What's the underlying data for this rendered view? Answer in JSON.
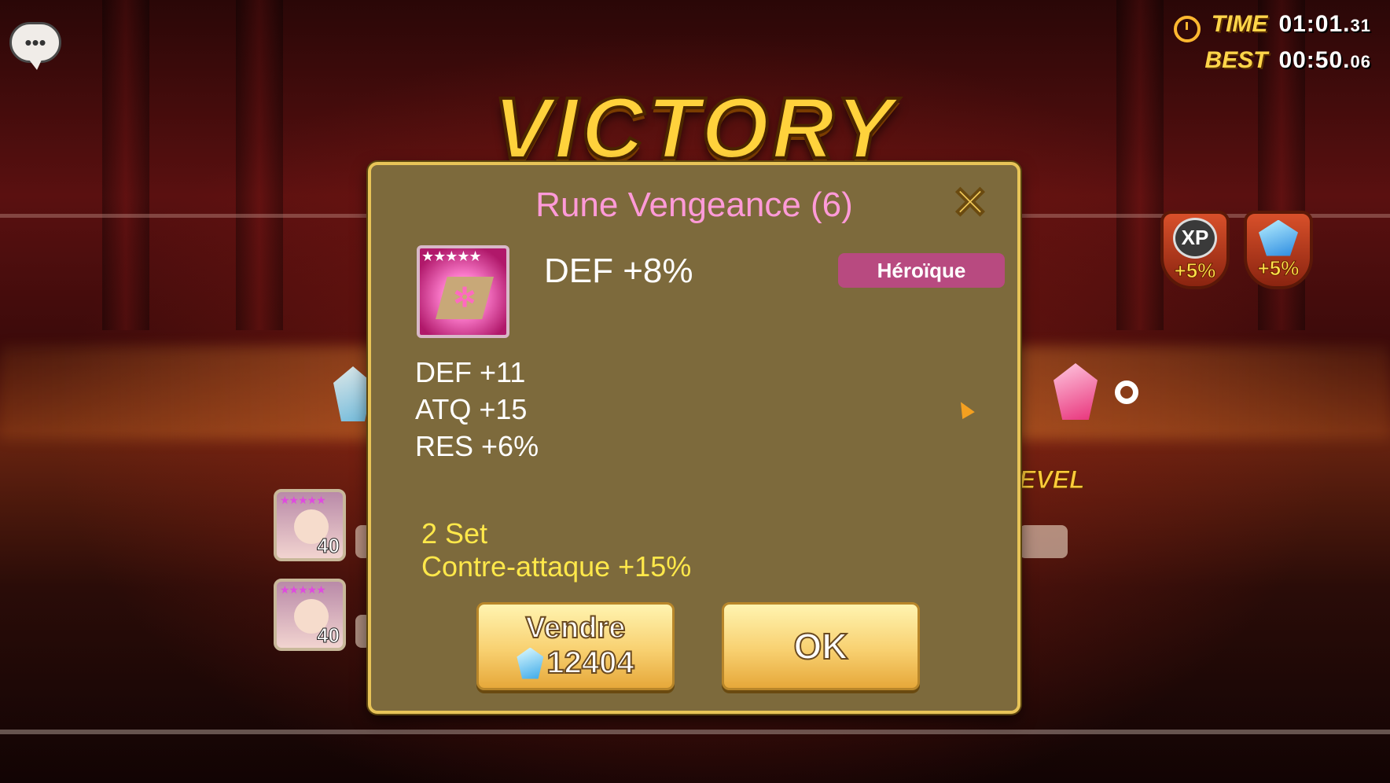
{
  "timer": {
    "time_label": "TIME",
    "time_main": "01:01.",
    "time_frac": "31",
    "best_label": "BEST",
    "best_main": "00:50.",
    "best_frac": "06"
  },
  "banner": {
    "title": "VICTORY"
  },
  "chat": {
    "icon": "chat-bubble-icon",
    "glyph": "•••"
  },
  "bonuses": [
    {
      "icon": "xp-icon",
      "icon_text": "XP",
      "value": "+5%"
    },
    {
      "icon": "crystal-icon",
      "icon_text": "",
      "value": "+5%"
    }
  ],
  "background_text": {
    "level": "EVEL"
  },
  "heroes": [
    {
      "stars": "★★★★★",
      "level": "40"
    },
    {
      "stars": "★★★★★",
      "level": "40"
    }
  ],
  "rune_dialog": {
    "title": "Rune Vengeance (6)",
    "close_glyph": "✕",
    "stars": "★★★★★",
    "rune_glyph": "✲",
    "main_stat": "DEF +8%",
    "rarity": "Héroïque",
    "substats": [
      "DEF +11",
      "ATQ +15",
      "RES +6%"
    ],
    "set_count": "2 Set",
    "set_effect": "Contre-attaque +15%",
    "sell_label": "Vendre",
    "sell_price": "12404",
    "ok_label": "OK"
  },
  "colors": {
    "title_pink": "#ff9ad8",
    "set_yellow": "#ffe84a",
    "rarity_bg": "#b84a80",
    "panel_bg": "#7d6a3c",
    "victory_gold": "#ffd23c"
  }
}
